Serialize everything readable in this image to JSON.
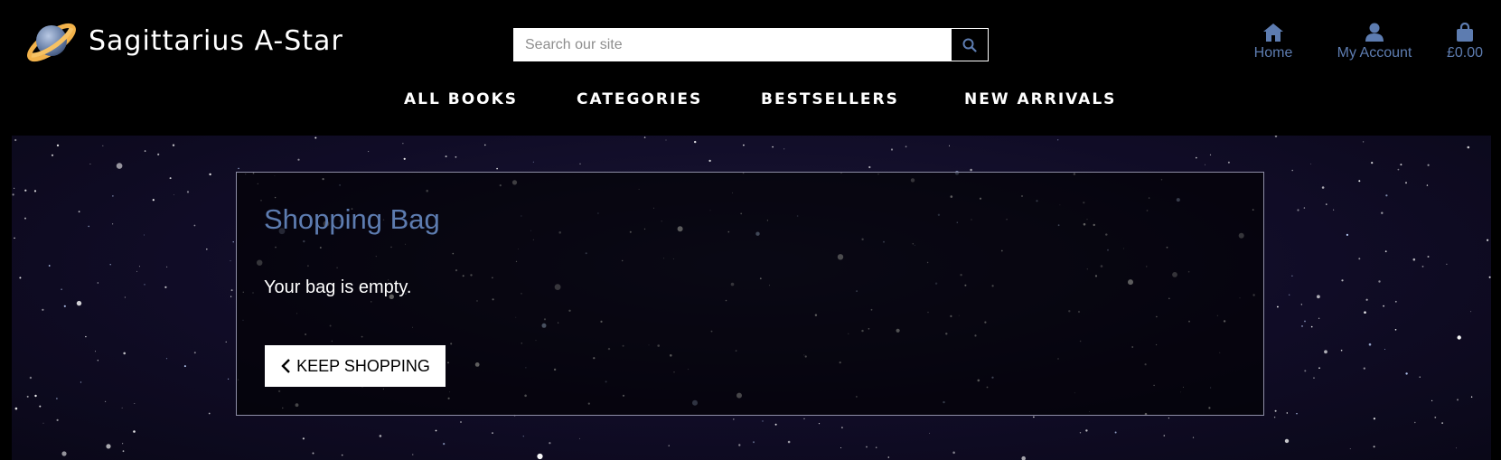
{
  "brand": {
    "name": "Sagittarius A-Star",
    "logo_icon": "planet-ring-icon"
  },
  "search": {
    "placeholder": "Search our site",
    "value": "",
    "icon": "search-icon"
  },
  "top_links": {
    "home_label": "Home",
    "account_label": "My Account",
    "bag_total": "£0.00"
  },
  "nav": {
    "items": [
      "ALL BOOKS",
      "CATEGORIES",
      "BESTSELLERS",
      "NEW ARRIVALS"
    ]
  },
  "bag": {
    "title": "Shopping Bag",
    "message": "Your bag is empty.",
    "keep_shopping_label": "KEEP SHOPPING"
  },
  "colors": {
    "accent": "#5d7cb0",
    "header_bg": "#000000",
    "panel_border": "#8e8ea6"
  }
}
